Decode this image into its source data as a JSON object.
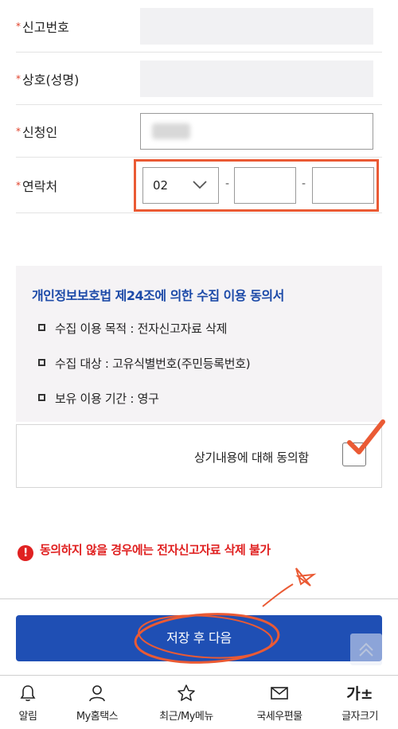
{
  "form": {
    "report_number": {
      "label": "신고번호"
    },
    "business_name": {
      "label": "상호(성명)"
    },
    "applicant": {
      "label": "신청인"
    },
    "contact": {
      "label": "연락처",
      "area_code": "02",
      "separator": "-"
    }
  },
  "consent": {
    "title": "개인정보보호법 제24조에 의한 수집 이용 동의서",
    "items": [
      "수집 이용 목적 : 전자신고자료 삭제",
      "수집 대상 : 고유식별번호(주민등록번호)",
      "보유 이용 기간 : 영구"
    ],
    "agree_label": "상기내용에 대해 동의함"
  },
  "warning": {
    "icon": "exclamation-icon",
    "text": "동의하지 않을 경우에는 전자신고자료 삭제 불가"
  },
  "actions": {
    "save_next_label": "저장 후 다음"
  },
  "bottom_nav": [
    {
      "label": "알림",
      "icon": "bell-icon"
    },
    {
      "label": "My홈택스",
      "icon": "person-icon"
    },
    {
      "label": "최근/My메뉴",
      "icon": "star-icon"
    },
    {
      "label": "국세우편물",
      "icon": "mail-icon"
    },
    {
      "label": "글자크기",
      "icon": "font-size-icon",
      "glyph": "가±"
    }
  ],
  "colors": {
    "primary": "#1f4fb4",
    "highlight": "#ea5a34",
    "required": "#e0412a",
    "warning": "#e02121",
    "consent_title": "#1c4aa8"
  }
}
